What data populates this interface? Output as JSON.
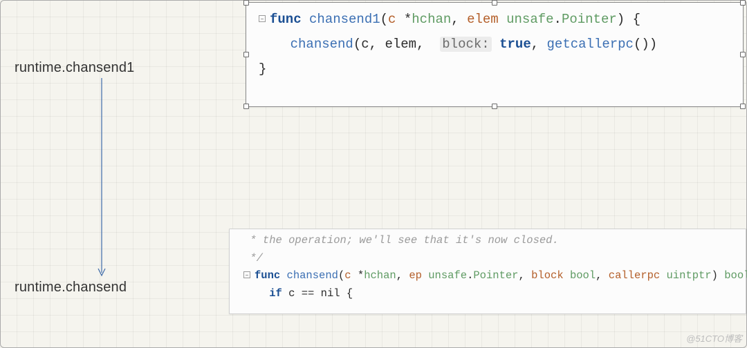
{
  "labels": {
    "top": "runtime.chansend1",
    "bottom": "runtime.chansend"
  },
  "snippet_top": {
    "kw_func": "func",
    "fn_name": "chansend1",
    "param_c": "c",
    "star": "*",
    "type_hchan": "hchan",
    "param_elem": "elem",
    "type_unsafe": "unsafe",
    "type_pointer": "Pointer",
    "lbrace": "{",
    "call_fn": "chansend",
    "arg1": "c",
    "arg2": "elem",
    "block_label": "block:",
    "block_val": "true",
    "call_pc": "getcallerpc",
    "rbrace": "}"
  },
  "snippet_bottom": {
    "comment1": " * the operation; we'll see that it's now closed.",
    "comment2": " */",
    "kw_func": "func",
    "fn_name": "chansend",
    "param_c": "c",
    "star": "*",
    "type_hchan": "hchan",
    "param_ep": "ep",
    "type_unsafe": "unsafe",
    "type_pointer": "Pointer",
    "param_block": "block",
    "type_bool": "bool",
    "param_callerpc": "callerpc",
    "type_uintptr": "uintptr",
    "ret_bool": "bool",
    "lbrace": "{",
    "kw_if": "if",
    "cond": "c == nil",
    "lbrace2": "{"
  },
  "watermark": "@51CTO博客"
}
